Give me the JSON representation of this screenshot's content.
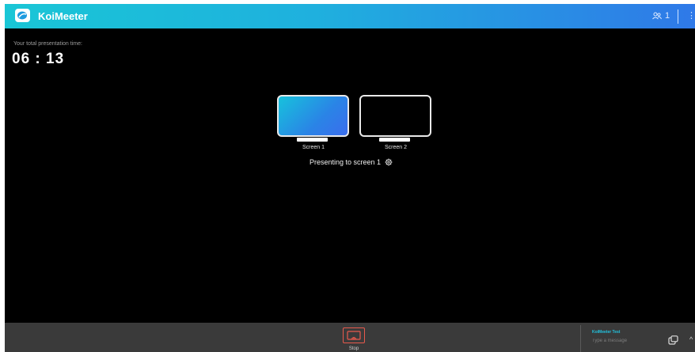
{
  "header": {
    "app_title": "KoiMeeter",
    "participant_count": "1",
    "icons": {
      "logo": "koimeeter-logo-icon",
      "participants": "participants-icon",
      "more": "more-vertical-icon"
    }
  },
  "timer": {
    "label": "Your total presentation time:",
    "value": "06 : 13"
  },
  "screens": [
    {
      "label": "Screen 1",
      "selected": true
    },
    {
      "label": "Screen 2",
      "selected": false
    }
  ],
  "status": {
    "text": "Presenting to screen 1",
    "icon": "settings-icon"
  },
  "bottom_bar": {
    "stop_label": "Stop",
    "stop_icon": "cast-stop-icon",
    "chat": {
      "name": "KoiMeeter Test",
      "placeholder": "Type a message",
      "attach_icon": "attach-icon",
      "expand_icon": "chevron-up-icon"
    }
  },
  "colors": {
    "header_gradient_start": "#19c6d6",
    "header_gradient_end": "#2f79e8",
    "stop_accent": "#e8594d",
    "chat_name": "#22c4e0"
  }
}
